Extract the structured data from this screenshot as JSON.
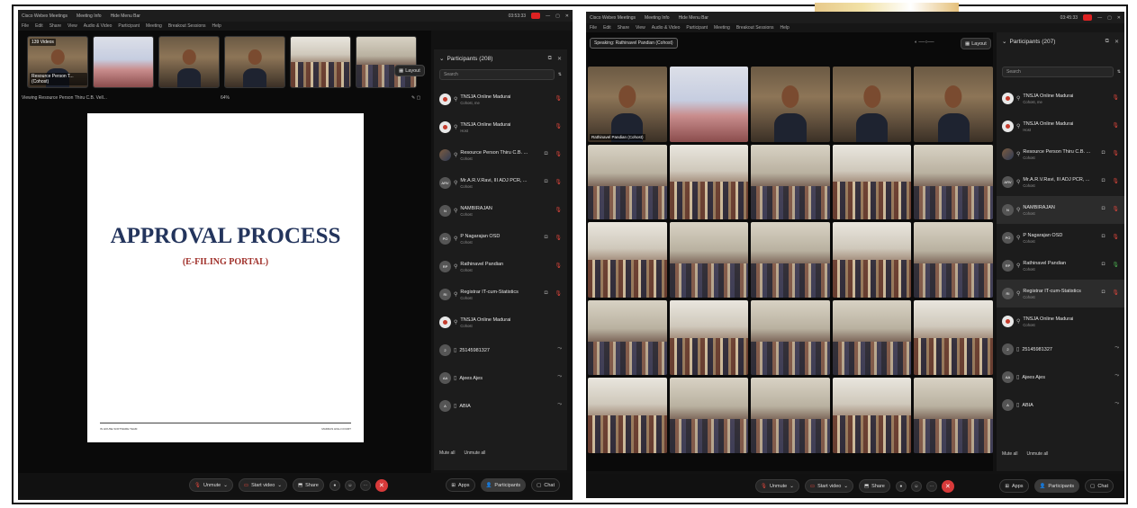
{
  "left": {
    "title_app": "Cisco Webex Meetings",
    "title_info": "Meeting Info",
    "title_hide": "Hide Menu Bar",
    "clock": "03:53:33",
    "menu": [
      "File",
      "Edit",
      "Share",
      "View",
      "Audio & Video",
      "Participant",
      "Meeting",
      "Breakout Sessions",
      "Help"
    ],
    "presenter_name": "Resource Person T... (Cohost)",
    "presenter_badge": "139 Videos",
    "viewing_text": "Viewing Resource Person Thiru C.B. Vell...",
    "zoom": "64%",
    "layout_label": "Layout",
    "slide": {
      "title": "APPROVAL PROCESS",
      "subtitle": "(E-FILING PORTAL)",
      "footer_left": "IN HOUSE SOFTWARE TEAM",
      "footer_right": "MADRAS HIGH COURT"
    },
    "panel": {
      "title": "Participants (208)",
      "search": "Search",
      "participants": [
        {
          "name": "TNSJA Online Madurai",
          "role": "Cohost, me",
          "avatar": "host",
          "mic": "red",
          "video": false
        },
        {
          "name": "TNSJA Online Madurai",
          "role": "Host",
          "avatar": "host",
          "mic": "red",
          "video": false
        },
        {
          "name": "Resource Person Thiru C.B. ...",
          "role": "Cohost",
          "avatar": "img",
          "mic": "red",
          "video": true
        },
        {
          "name": "Mr.A.R.V.Ravi, III ADJ PCR, ...",
          "role": "Cohost",
          "avatar": "ARV",
          "mic": "red",
          "video": true
        },
        {
          "name": "NAMBIRAJAN",
          "role": "Cohost",
          "avatar": "N",
          "mic": "red",
          "video": false
        },
        {
          "name": "P Nagarajan OSD",
          "role": "Cohost",
          "avatar": "PO",
          "mic": "red",
          "video": true
        },
        {
          "name": "Rathinavel Pandian",
          "role": "Cohost",
          "avatar": "RP",
          "mic": "red",
          "video": false
        },
        {
          "name": "Registrar IT-cum-Statistics",
          "role": "Cohost",
          "avatar": "RI",
          "mic": "red",
          "video": true
        },
        {
          "name": "TNSJA Online Madurai",
          "role": "Cohost",
          "avatar": "host",
          "mic": "",
          "video": false
        },
        {
          "name": "25145981327",
          "role": "",
          "avatar": "2",
          "mic": "grey",
          "video": false
        },
        {
          "name": "Ajees Ajes",
          "role": "",
          "avatar": "AA",
          "mic": "grey",
          "video": false
        },
        {
          "name": "ABIA",
          "role": "",
          "avatar": "A",
          "mic": "grey",
          "video": false
        }
      ],
      "mute_all": "Mute all",
      "unmute_all": "Unmute all"
    },
    "bottom": {
      "unmute": "Unmute",
      "start_video": "Start video",
      "share": "Share",
      "apps": "Apps",
      "participants": "Participants",
      "chat": "Chat"
    }
  },
  "right": {
    "title_app": "Cisco Webex Meetings",
    "title_info": "Meeting Info",
    "title_hide": "Hide Menu Bar",
    "clock": "03:45:33",
    "menu": [
      "File",
      "Edit",
      "Share",
      "View",
      "Audio & Video",
      "Participant",
      "Meeting",
      "Breakout Sessions",
      "Help"
    ],
    "speaking": "Speaking: Rathinavel Pandian (Cohost)",
    "layout_label": "Layout",
    "grid_first_label": "Rathinavel Pandian (Cohost)",
    "panel": {
      "title": "Participants (207)",
      "search": "Search",
      "participants": [
        {
          "name": "TNSJA Online Madurai",
          "role": "Cohost, me",
          "avatar": "host",
          "mic": "red",
          "video": false
        },
        {
          "name": "TNSJA Online Madurai",
          "role": "Host",
          "avatar": "host",
          "mic": "red",
          "video": false
        },
        {
          "name": "Resource Person Thiru C.B. ...",
          "role": "Cohost",
          "avatar": "img",
          "mic": "red",
          "video": true
        },
        {
          "name": "Mr.A.R.V.Ravi, III ADJ PCR, ...",
          "role": "Cohost",
          "avatar": "ARV",
          "mic": "red",
          "video": true
        },
        {
          "name": "NAMBIRAJAN",
          "role": "Cohost",
          "avatar": "N",
          "mic": "red",
          "video": true,
          "hl": true
        },
        {
          "name": "P Nagarajan OSD",
          "role": "Cohost",
          "avatar": "PO",
          "mic": "red",
          "video": true
        },
        {
          "name": "Rathinavel Pandian",
          "role": "Cohost",
          "avatar": "RP",
          "mic": "green",
          "video": true
        },
        {
          "name": "Registrar IT-cum-Statistics",
          "role": "Cohost",
          "avatar": "RI",
          "mic": "red",
          "video": true,
          "hl": true
        },
        {
          "name": "TNSJA Online Madurai",
          "role": "Cohost",
          "avatar": "host",
          "mic": "",
          "video": false
        },
        {
          "name": "25145981327",
          "role": "",
          "avatar": "2",
          "mic": "grey",
          "video": false
        },
        {
          "name": "Ajees Ajes",
          "role": "",
          "avatar": "AA",
          "mic": "grey",
          "video": false
        },
        {
          "name": "ABIA",
          "role": "",
          "avatar": "A",
          "mic": "grey",
          "video": false
        }
      ],
      "mute_all": "Mute all",
      "unmute_all": "Unmute all"
    },
    "bottom": {
      "unmute": "Unmute",
      "start_video": "Start video",
      "share": "Share",
      "apps": "Apps",
      "participants": "Participants",
      "chat": "Chat"
    }
  },
  "colors": {
    "accent_red": "#d83a3a",
    "panel_bg": "#1c1c1c",
    "slide_title": "#23345c",
    "slide_sub": "#a0302a"
  }
}
